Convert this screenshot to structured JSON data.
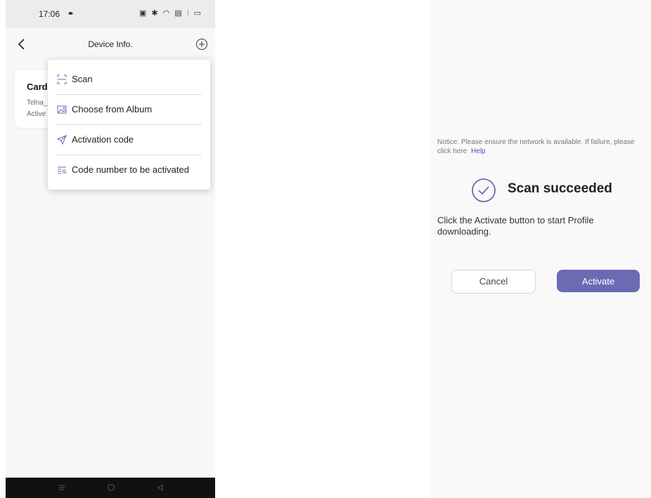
{
  "left_screen": {
    "status_bar": {
      "time": "17:06",
      "icons_text": "▣ ✱ ◠ ▤ ⫶ ▭"
    },
    "header": {
      "title": "Device Info."
    },
    "card": {
      "title": "Card",
      "line1": "Telna_",
      "line2": "Active"
    },
    "menu": {
      "items": [
        {
          "label": "Scan",
          "icon": "scan-icon"
        },
        {
          "label": "Choose from Album",
          "icon": "album-icon"
        },
        {
          "label": "Activation code",
          "icon": "send-icon"
        },
        {
          "label": "Code number to be activated",
          "icon": "code-list-icon"
        }
      ]
    }
  },
  "right_screen": {
    "notice": "Notice: Please ensure the network is available. If failure, please click here",
    "help_link": "Help",
    "title": "Scan succeeded",
    "description": "Click the Activate button to start Profile downloading.",
    "cancel_label": "Cancel",
    "activate_label": "Activate"
  },
  "colors": {
    "accent": "#6b6bb4",
    "help_link": "#4e5aa8"
  }
}
